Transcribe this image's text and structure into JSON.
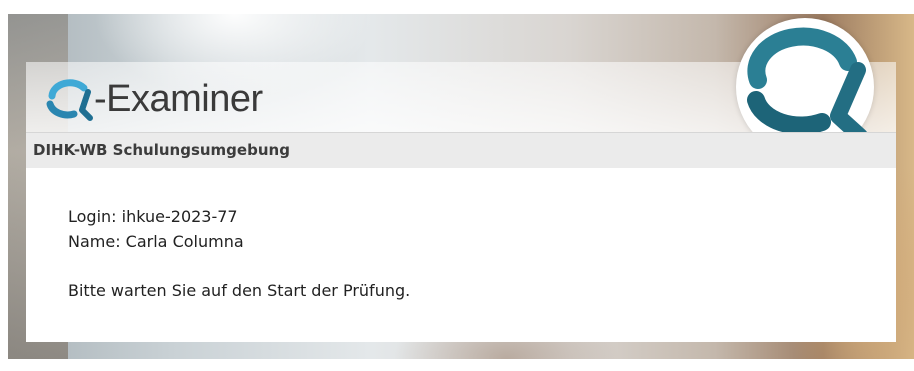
{
  "brand": {
    "logo_text": "-Examiner",
    "logo_icon": "q-logo-icon",
    "badge_icon": "q-badge-icon",
    "accent_color": "#2e8fb5",
    "dark_accent_color": "#1d5f72"
  },
  "header": {
    "subtitle": "DIHK-WB Schulungsumgebung"
  },
  "session": {
    "login_line": "Login: ihkue-2023-77",
    "name_line": "Name: Carla Columna",
    "status_message": "Bitte warten Sie auf den Start der Prüfung."
  }
}
